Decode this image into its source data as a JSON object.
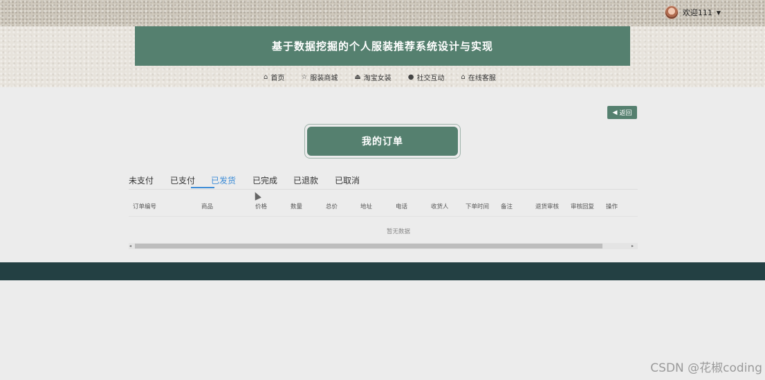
{
  "user": {
    "greeting": "欢迎111",
    "caret": "▼",
    "avatar_icon": "avatar-icon"
  },
  "header": {
    "title": "基于数据挖掘的个人服装推荐系统设计与实现"
  },
  "nav": {
    "items": [
      {
        "label": "首页",
        "icon": "⌂",
        "icon_name": "home-icon"
      },
      {
        "label": "服装商城",
        "icon": "☆",
        "icon_name": "star-icon"
      },
      {
        "label": "淘宝女装",
        "icon": "⏏",
        "icon_name": "bag-icon"
      },
      {
        "label": "社交互动",
        "icon": "●",
        "icon_name": "info-icon"
      },
      {
        "label": "在线客服",
        "icon": "⌂",
        "icon_name": "home-icon"
      }
    ]
  },
  "back_button": {
    "label": "返回",
    "icon": "◀"
  },
  "page_title": "我的订单",
  "tabs": [
    {
      "label": "未支付",
      "active": false
    },
    {
      "label": "已支付",
      "active": false
    },
    {
      "label": "已发货",
      "active": true
    },
    {
      "label": "已完成",
      "active": false
    },
    {
      "label": "已退款",
      "active": false
    },
    {
      "label": "已取消",
      "active": false
    }
  ],
  "table": {
    "columns": [
      "订单编号",
      "商品",
      "价格",
      "数量",
      "总价",
      "地址",
      "电话",
      "收货人",
      "下单时间",
      "备注",
      "退货审核",
      "审核回复",
      "操作"
    ],
    "empty_text": "暂无数据"
  },
  "scrollbar": {
    "left_arrow": "◂",
    "right_arrow": "▸"
  },
  "watermark": "CSDN @花椒coding",
  "colors": {
    "primary": "#55806f",
    "active_tab": "#3b8bd6",
    "footer": "#234043"
  }
}
